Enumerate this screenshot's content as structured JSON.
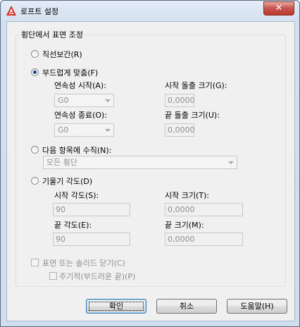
{
  "window": {
    "title": "로프트 설정",
    "close_label": "✕"
  },
  "group": {
    "title": "횡단에서 표면 조정",
    "ruled": {
      "label": "직선보간(R)",
      "selected": false
    },
    "smooth": {
      "label": "부드럽게 맞춤(F)",
      "selected": true,
      "start_continuity": {
        "label": "연속성 시작(A):",
        "value": "G0"
      },
      "start_bulge": {
        "label": "시작 돌출 크기(G):",
        "value": "0,0000"
      },
      "end_continuity": {
        "label": "연속성 종료(O):",
        "value": "G0"
      },
      "end_bulge": {
        "label": "끝 돌출 크기(U):",
        "value": "0,0000"
      }
    },
    "normal": {
      "label": "다음 항목에 수직(N):",
      "selected": false,
      "value": "모든 횡단"
    },
    "draft": {
      "label": "기울기 각도(D)",
      "selected": false,
      "start_angle": {
        "label": "시작 각도(S):",
        "value": "90"
      },
      "start_magnitude": {
        "label": "시작 크기(T):",
        "value": "0,0000"
      },
      "end_angle": {
        "label": "끝 각도(E):",
        "value": "90"
      },
      "end_magnitude": {
        "label": "끝 크기(M):",
        "value": "0,0000"
      }
    }
  },
  "close_solid": {
    "label": "표면 또는 솔리드 닫기(C)",
    "checked": false
  },
  "periodic": {
    "label": "주기적(부드러운 끝)(P)",
    "checked": false
  },
  "buttons": {
    "ok": "확인",
    "cancel": "취소",
    "help": "도움말(H)"
  }
}
